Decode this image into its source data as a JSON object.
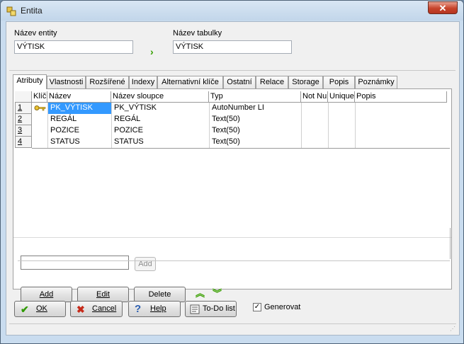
{
  "window": {
    "title": "Entita"
  },
  "form": {
    "entity_label": "Název entity",
    "entity_value": "VÝTISK",
    "table_label": "Název tabulky",
    "table_value": "VÝTISK"
  },
  "tabs": [
    "Atributy",
    "Vlastnosti",
    "Rozšířené",
    "Indexy",
    "Alternativní klíče",
    "Ostatní",
    "Relace",
    "Storage",
    "Popis",
    "Poznámky"
  ],
  "grid": {
    "columns": [
      "Klíč",
      "Název",
      "Název sloupce",
      "Typ",
      "Not Nu",
      "Unique",
      "Popis"
    ],
    "rows": [
      {
        "num": "1",
        "name": "PK_VÝTISK",
        "column": "PK_VÝTISK",
        "type": "AutoNumber LI"
      },
      {
        "num": "2",
        "name": "REGÁL",
        "column": "REGÁL",
        "type": "Text(50)"
      },
      {
        "num": "3",
        "name": "POZICE",
        "column": "POZICE",
        "type": "Text(50)"
      },
      {
        "num": "4",
        "name": "STATUS",
        "column": "STATUS",
        "type": "Text(50)"
      }
    ]
  },
  "add_input": {
    "value": "",
    "button": "Add"
  },
  "buttons": {
    "add": "Add",
    "edit": "Edit",
    "delete": "Delete"
  },
  "footer": {
    "ok": "OK",
    "cancel": "Cancel",
    "help": "Help",
    "todo": "To-Do list",
    "generate": "Generovat",
    "generate_checked": true
  },
  "colors": {
    "selection": "#3399ff",
    "arrows": "#35a000",
    "close": "#c7432b"
  }
}
